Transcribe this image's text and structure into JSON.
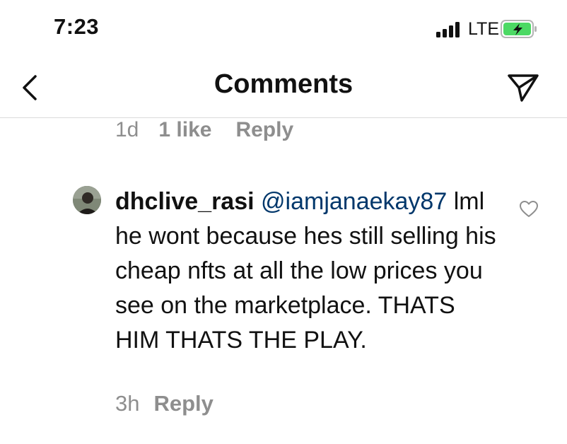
{
  "status_bar": {
    "time": "7:23",
    "network": "LTE",
    "battery_color": "#4cd964"
  },
  "nav": {
    "title": "Comments",
    "back_icon": "chevron-left-icon",
    "share_icon": "paper-plane-icon"
  },
  "previous_comment": {
    "age": "1d",
    "likes": "1 like",
    "reply_label": "Reply"
  },
  "comment": {
    "username": "dhclive_rasi",
    "mention": "@iamjanaekay87",
    "text": "lml he wont because hes still selling his cheap nfts at all the low prices you see on the marketplace. THATS HIM THATS THE PLAY.",
    "age": "3h",
    "reply_label": "Reply",
    "like_icon": "heart-outline-icon"
  },
  "colors": {
    "text": "#111111",
    "muted": "#8e8e8e",
    "mention": "#00376b",
    "divider": "#dbdbdb"
  }
}
